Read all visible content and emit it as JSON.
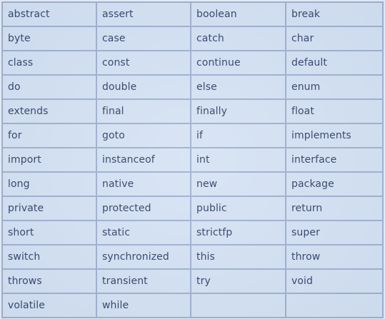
{
  "keywords_table": {
    "rows": [
      [
        "abstract",
        "assert",
        "boolean",
        "break"
      ],
      [
        "byte",
        "case",
        "catch",
        "char"
      ],
      [
        "class",
        "const",
        "continue",
        "default"
      ],
      [
        "do",
        "double",
        "else",
        "enum"
      ],
      [
        "extends",
        "final",
        "finally",
        "float"
      ],
      [
        "for",
        "goto",
        "if",
        "implements"
      ],
      [
        "import",
        "instanceof",
        "int",
        "interface"
      ],
      [
        "long",
        "native",
        "new",
        "package"
      ],
      [
        "private",
        "protected",
        "public",
        "return"
      ],
      [
        "short",
        "static",
        "strictfp",
        "super"
      ],
      [
        "switch",
        "synchronized",
        "this",
        "throw"
      ],
      [
        "throws",
        "transient",
        "try",
        "void"
      ],
      [
        "volatile",
        "while",
        "",
        ""
      ]
    ]
  },
  "colors": {
    "cell_background": "#d6e3f4",
    "border": "#9fb0cd",
    "text": "#2f3f66"
  }
}
